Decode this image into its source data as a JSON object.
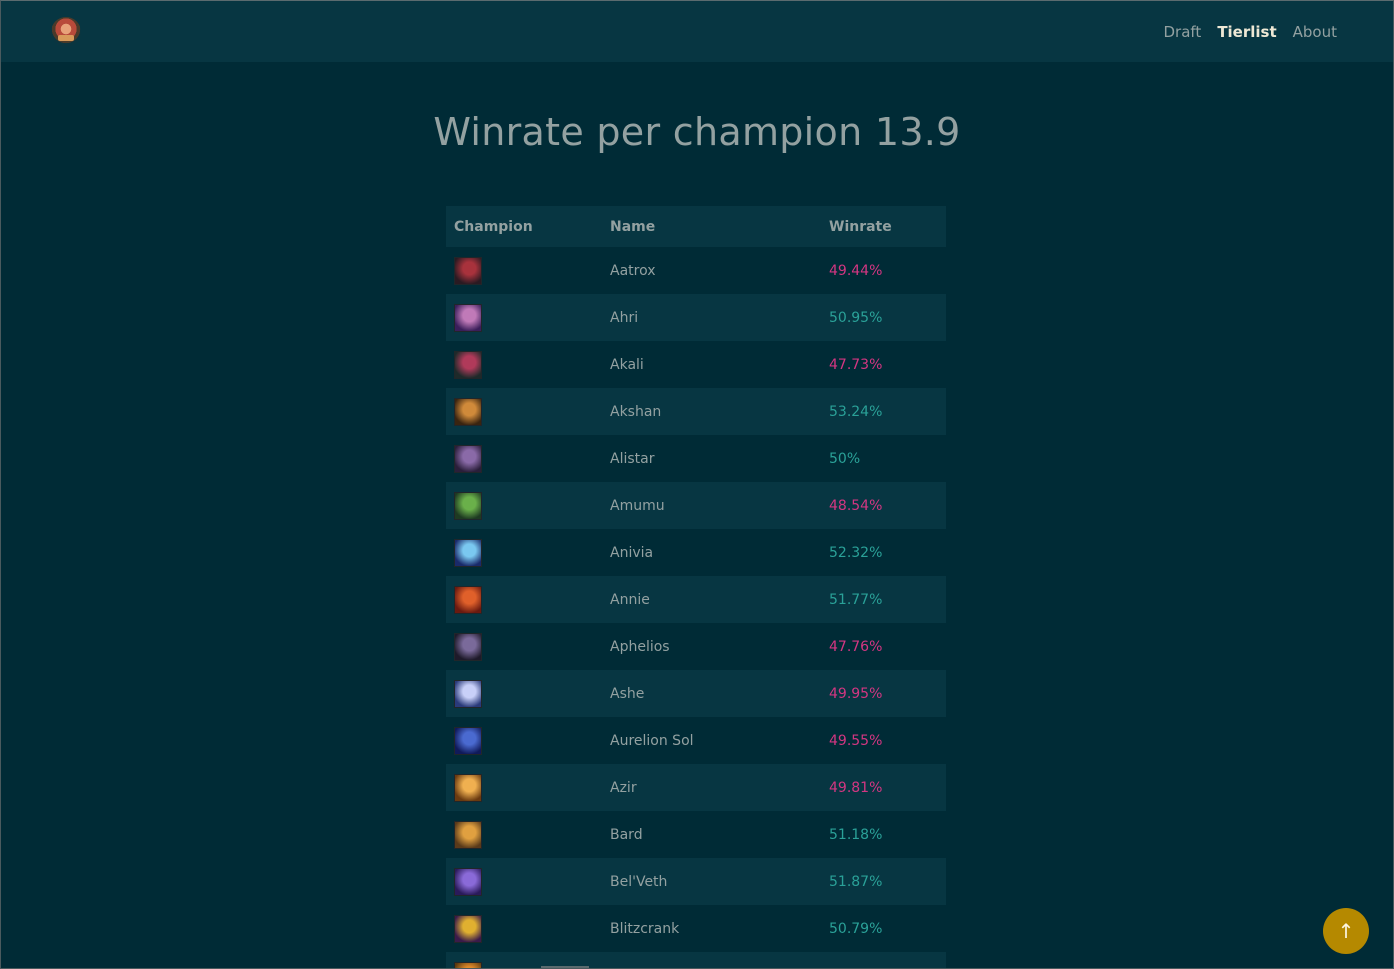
{
  "nav": {
    "links": [
      {
        "label": "Draft",
        "active": false
      },
      {
        "label": "Tierlist",
        "active": true
      },
      {
        "label": "About",
        "active": false
      }
    ]
  },
  "page": {
    "title": "Winrate per champion 13.9"
  },
  "table": {
    "headers": {
      "champion": "Champion",
      "name": "Name",
      "winrate": "Winrate"
    },
    "rows": [
      {
        "name": "Aatrox",
        "winrate": "49.44%",
        "trend": "low",
        "colors": [
          "#2a1a22",
          "#a8323c"
        ]
      },
      {
        "name": "Ahri",
        "winrate": "50.95%",
        "trend": "high",
        "colors": [
          "#3a1e5a",
          "#c07ab8"
        ]
      },
      {
        "name": "Akali",
        "winrate": "47.73%",
        "trend": "low",
        "colors": [
          "#1e2a2a",
          "#b03a5a"
        ]
      },
      {
        "name": "Akshan",
        "winrate": "53.24%",
        "trend": "high",
        "colors": [
          "#3a2410",
          "#d08a3a"
        ]
      },
      {
        "name": "Alistar",
        "winrate": "50%",
        "trend": "high",
        "colors": [
          "#2a1e3a",
          "#8a6aa8"
        ]
      },
      {
        "name": "Amumu",
        "winrate": "48.54%",
        "trend": "low",
        "colors": [
          "#1e3a22",
          "#6ab04a"
        ]
      },
      {
        "name": "Anivia",
        "winrate": "52.32%",
        "trend": "high",
        "colors": [
          "#1a2a6a",
          "#7ac8f0"
        ]
      },
      {
        "name": "Annie",
        "winrate": "51.77%",
        "trend": "high",
        "colors": [
          "#6a1a10",
          "#e0602a"
        ]
      },
      {
        "name": "Aphelios",
        "winrate": "47.76%",
        "trend": "low",
        "colors": [
          "#1e1a2a",
          "#7a6a9a"
        ]
      },
      {
        "name": "Ashe",
        "winrate": "49.95%",
        "trend": "low",
        "colors": [
          "#2a3a7a",
          "#c8d0f8"
        ]
      },
      {
        "name": "Aurelion Sol",
        "winrate": "49.55%",
        "trend": "low",
        "colors": [
          "#101a5a",
          "#4a6ad0"
        ]
      },
      {
        "name": "Azir",
        "winrate": "49.81%",
        "trend": "low",
        "colors": [
          "#6a3a10",
          "#f0b050"
        ]
      },
      {
        "name": "Bard",
        "winrate": "51.18%",
        "trend": "high",
        "colors": [
          "#5a3a1a",
          "#e0a040"
        ]
      },
      {
        "name": "Bel'Veth",
        "winrate": "51.87%",
        "trend": "high",
        "colors": [
          "#2a1a5a",
          "#8a6ad8"
        ]
      },
      {
        "name": "Blitzcrank",
        "winrate": "50.79%",
        "trend": "high",
        "colors": [
          "#3a1a4a",
          "#e0b030"
        ]
      },
      {
        "name": "",
        "winrate": "",
        "trend": "high",
        "colors": [
          "#5a3a10",
          "#e08a2a"
        ]
      }
    ]
  },
  "scroll_top": {
    "icon": "arrow-up-icon",
    "glyph": "↑"
  },
  "colors": {
    "background": "#002b36",
    "navbar": "#073642",
    "winrate_low": "#d33682",
    "winrate_high": "#2aa198",
    "scroll_top": "#b58900"
  }
}
